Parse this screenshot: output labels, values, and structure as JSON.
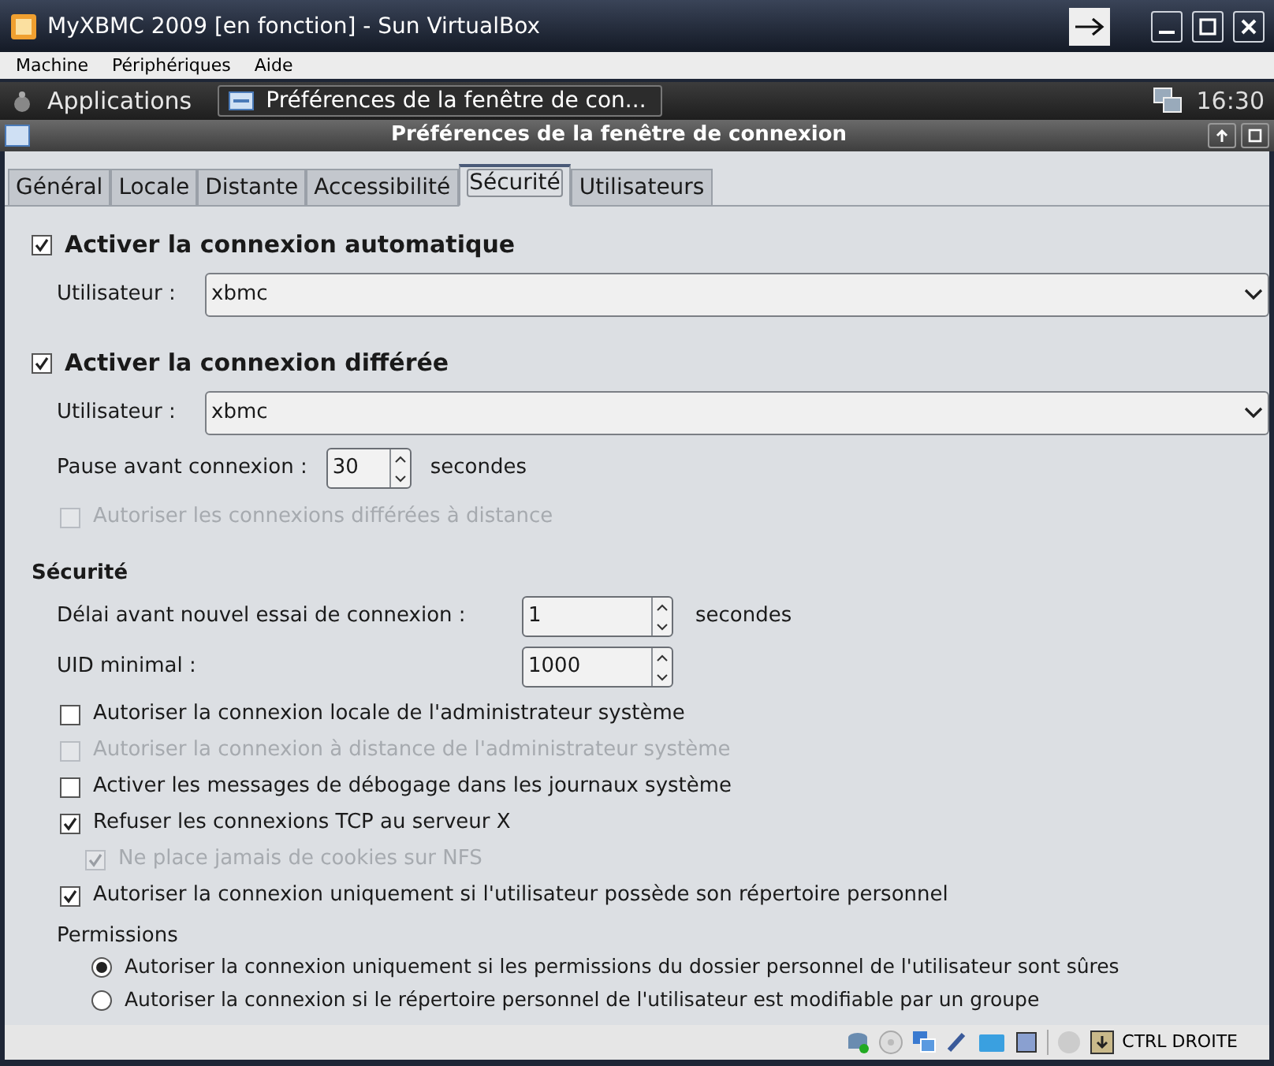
{
  "window": {
    "title": "MyXBMC 2009 [en fonction] - Sun VirtualBox"
  },
  "menu": [
    "Machine",
    "Périphériques",
    "Aide"
  ],
  "panel": {
    "applications": "Applications",
    "task": "Préférences de la fenêtre de con...",
    "clock": "16:30"
  },
  "dialog": {
    "title": "Préférences de la fenêtre de connexion"
  },
  "tabs": [
    {
      "label": "Général",
      "selected": false
    },
    {
      "label": "Locale",
      "selected": false
    },
    {
      "label": "Distante",
      "selected": false
    },
    {
      "label": "Accessibilité",
      "selected": false
    },
    {
      "label": "Sécurité",
      "selected": true
    },
    {
      "label": "Utilisateurs",
      "selected": false
    }
  ],
  "auto_login": {
    "label": "Activer la connexion automatique",
    "checked": true,
    "user": {
      "label": "Utilisateur :",
      "value": "xbmc"
    }
  },
  "timed_login": {
    "label": "Activer la connexion différée",
    "checked": true,
    "user": {
      "label": "Utilisateur :",
      "value": "xbmc"
    },
    "pause": {
      "label": "Pause avant connexion :",
      "value": "30",
      "unit": "secondes"
    },
    "remote": {
      "label": "Autoriser les connexions différées à distance",
      "checked": false,
      "disabled": true
    }
  },
  "security": {
    "heading": "Sécurité",
    "retry": {
      "label": "Délai avant nouvel essai de connexion :",
      "value": "1",
      "unit": "secondes"
    },
    "uid": {
      "label": "UID minimal :",
      "value": "1000"
    },
    "options": [
      {
        "label": "Autoriser la connexion locale de l'administrateur système",
        "checked": false,
        "disabled": false
      },
      {
        "label": "Autoriser la connexion à distance de l'administrateur système",
        "checked": false,
        "disabled": true
      },
      {
        "label": "Activer les messages de débogage dans les journaux système",
        "checked": false,
        "disabled": false
      },
      {
        "label": "Refuser les connexions TCP au serveur X",
        "checked": true,
        "disabled": false,
        "children": [
          {
            "label": "Ne place jamais de cookies sur NFS",
            "checked": true,
            "disabled": true
          }
        ]
      },
      {
        "label": "Autoriser la connexion uniquement si l'utilisateur possède son répertoire personnel",
        "checked": true,
        "disabled": false
      }
    ],
    "permissions": {
      "label": "Permissions",
      "options": [
        {
          "label": "Autoriser la connexion uniquement si les permissions du dossier personnel de l'utilisateur sont sûres",
          "selected": true
        },
        {
          "label": "Autoriser la connexion si le répertoire personnel de l'utilisateur est modifiable par un groupe",
          "selected": false
        }
      ]
    }
  },
  "status_bar": {
    "host_key": "CTRL DROITE"
  }
}
